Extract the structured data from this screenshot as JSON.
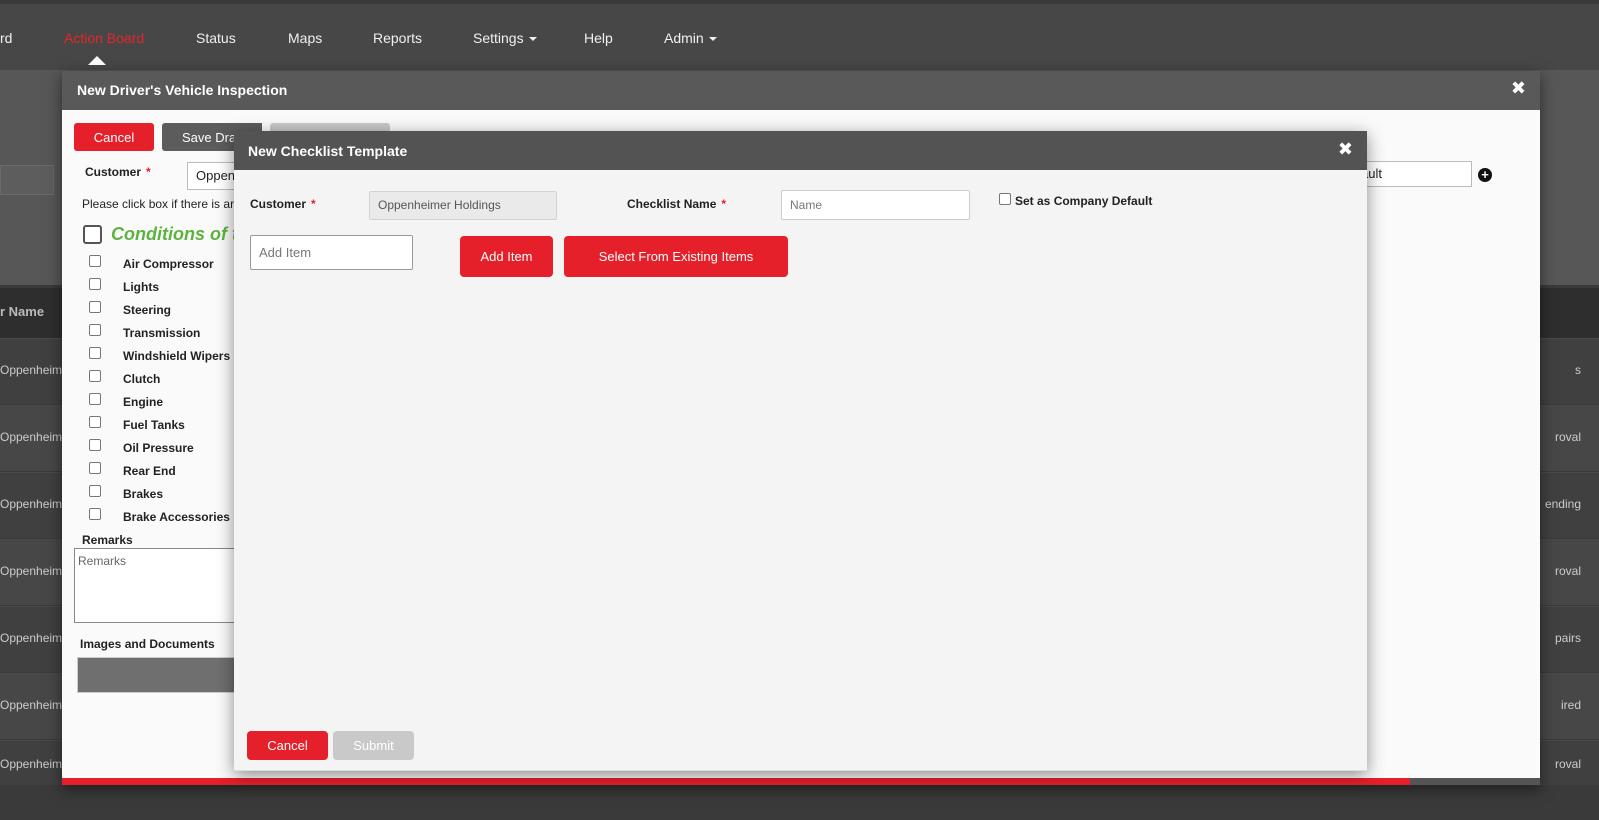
{
  "navbar": {
    "items": [
      {
        "label": "rd",
        "active": false
      },
      {
        "label": "Action Board",
        "active": true
      },
      {
        "label": "Status",
        "active": false
      },
      {
        "label": "Maps",
        "active": false
      },
      {
        "label": "Reports",
        "active": false
      },
      {
        "label": "Settings",
        "active": false,
        "dropdown": true
      },
      {
        "label": "Help",
        "active": false
      },
      {
        "label": "Admin",
        "active": false,
        "dropdown": true
      }
    ]
  },
  "background_table": {
    "header_label": "r Name",
    "rows": [
      {
        "left": "Oppenheim",
        "right": "s"
      },
      {
        "left": "Oppenheim",
        "right": "roval"
      },
      {
        "left": "Oppenheim",
        "right": "ending"
      },
      {
        "left": "Oppenheim",
        "right": "roval"
      },
      {
        "left": "Oppenheim",
        "right": "pairs"
      },
      {
        "left": "Oppenheim",
        "right": "ired"
      },
      {
        "left": "Oppenheim",
        "right": "roval"
      }
    ]
  },
  "inspection_modal": {
    "title": "New Driver's Vehicle Inspection",
    "cancel_label": "Cancel",
    "save_draft_label": "Save Dra",
    "customer_label": "Customer",
    "customer_value": "Oppen",
    "default_field_value": "ault",
    "instruction": "Please click box if there is ar",
    "conditions_title": "Conditions of th",
    "checklist_items": [
      "Air Compressor",
      "Lights",
      "Steering",
      "Transmission",
      "Windshield Wipers",
      "Clutch",
      "Engine",
      "Fuel Tanks",
      "Oil Pressure",
      "Rear End",
      "Brakes",
      "Brake Accessories"
    ],
    "remarks_label": "Remarks",
    "remarks_placeholder": "Remarks",
    "images_label": "Images and Documents",
    "progress_fraction": 0.912
  },
  "template_modal": {
    "title": "New Checklist Template",
    "customer_label": "Customer",
    "customer_value": "Oppenheimer Holdings",
    "checklist_name_label": "Checklist Name",
    "checklist_name_placeholder": "Name",
    "company_default_label": "Set as Company Default",
    "add_item_placeholder": "Add Item",
    "add_item_button": "Add Item",
    "select_existing_button": "Select From Existing Items",
    "cancel_button": "Cancel",
    "submit_button": "Submit"
  },
  "theme": {
    "accent_red": "#e5202a",
    "condition_green": "#5db33e",
    "header_grey": "#595959"
  }
}
